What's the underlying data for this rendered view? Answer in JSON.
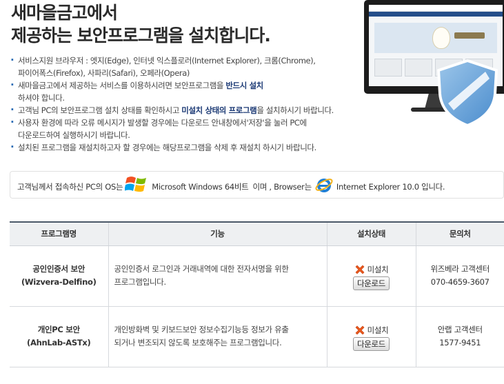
{
  "header": {
    "title_line1": "새마을금고에서",
    "title_line2": "제공하는 보안프로그램을 설치합니다."
  },
  "notes": [
    {
      "text_line1": "서비스지원 브라우저 : 엣지(Edge), 인터넷 익스플로러(Internet Explorer), 크롬(Chrome),",
      "text_line2": "파이어폭스(Firefox), 사파리(Safari), 오페라(Opera)"
    },
    {
      "text_before": "새마을금고에서 제공하는 서비스를 이용하시려면 보안프로그램을 ",
      "strong": "반드시 설치",
      "text_line2": "하셔야 합니다."
    },
    {
      "text_before": "고객님 PC의 보안프로그램 설치 상태를 확인하시고 ",
      "strong": "미설치 상태의 프로그램",
      "text_after": "을 설치하시기 바랍니다."
    },
    {
      "text_line1": "사용자 환경에 따라 오류 메시지가 발생할 경우에는 다운로드 안내창에서'저장'을 눌러 PC에",
      "text_line2": "다운로드하여 실행하시기 바랍니다."
    },
    {
      "text_line1": "설치된 프로그램을 재설치하고자 할 경우에는 해당프로그램을 삭제 후 재설치 하시기 바랍니다."
    }
  ],
  "os_info": {
    "prefix": "고객님께서 접속하신 PC의 OS는",
    "os_name": "Microsoft Windows 64비트",
    "mid": "이며 , Browser는",
    "browser": "Internet Explorer 10.0 입니다."
  },
  "table": {
    "headers": [
      "프로그램명",
      "기능",
      "설치상태",
      "문의처"
    ],
    "rows": [
      {
        "name": "공인인증서 보안",
        "product": "(Wizvera-Delfino)",
        "desc_line1": "공인인증서 로그인과 거래내역에 대한 전자서명을 위한",
        "desc_line2": "프로그램입니다.",
        "status": "미설치",
        "download": "다운로드",
        "contact_name": "위즈베라 고객센터",
        "contact_phone": "070-4659-3607"
      },
      {
        "name": "개인PC 보안",
        "product": "(AhnLab-ASTx)",
        "desc_line1": "개인방화벽 및 키보드보안 정보수집기능등 정보가 유출",
        "desc_line2": "되거나 변조되지 않도록 보호해주는 프로그램입니다.",
        "status": "미설치",
        "download": "다운로드",
        "contact_name": "안랩 고객센터",
        "contact_phone": "1577-9451"
      }
    ]
  },
  "colors": {
    "accent": "#1c3a75",
    "bullet": "#2c6db5",
    "table_header_bg": "#eef0f2",
    "status_x": "#e8591e"
  },
  "icons": {
    "hero": "monitor-with-security-shield",
    "os": "windows-flag-icon",
    "browser": "internet-explorer-icon",
    "status": "red-x-icon"
  }
}
